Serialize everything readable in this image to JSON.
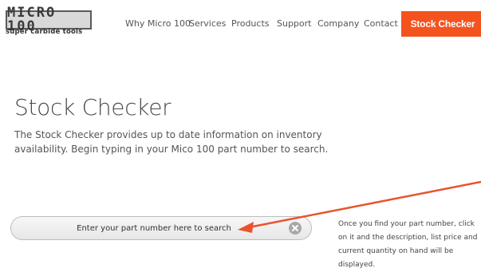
{
  "brand": {
    "logo_main": "MICRO 100",
    "logo_tagline": "super carbide tools"
  },
  "nav": {
    "items": [
      {
        "label": "Why Micro 100"
      },
      {
        "label": "Services"
      },
      {
        "label": "Products"
      },
      {
        "label": "Support"
      },
      {
        "label": "Company"
      },
      {
        "label": "Contact"
      }
    ],
    "cta_label": "Stock Checker"
  },
  "main": {
    "title": "Stock Checker",
    "intro": "The Stock Checker provides up to date information on inventory availability. Begin typing in your Mico 100 part number to search.",
    "search": {
      "placeholder": "Enter your part number here to search",
      "value": ""
    },
    "help_text": "Once you find your part number, click on it and the description, list price and current quantity on hand will be displayed."
  },
  "colors": {
    "accent": "#f4531e",
    "annotation_arrow": "#e8542c",
    "frame_border": "#f0805a",
    "clear_button": "#a8a8a8"
  },
  "icons": {
    "clear": "close-icon"
  }
}
